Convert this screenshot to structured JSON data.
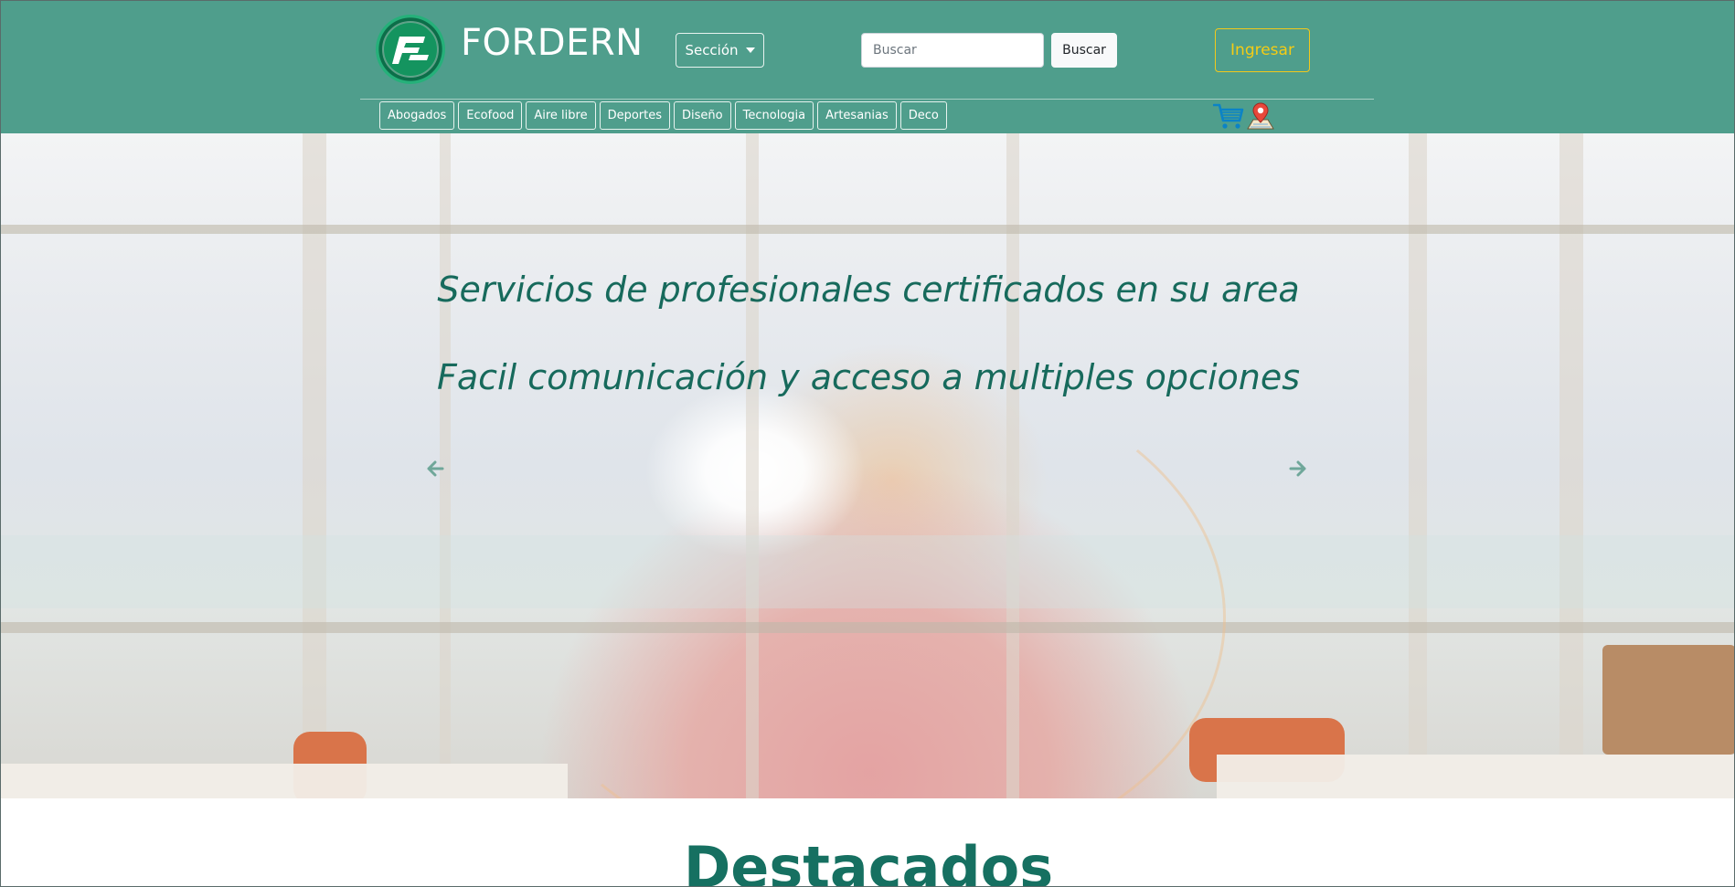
{
  "header": {
    "brand": "FORDERN",
    "section_button": "Sección",
    "search": {
      "placeholder": "Buscar",
      "value": ""
    },
    "search_button": "Buscar",
    "login_button": "Ingresar",
    "categories": [
      "Abogados",
      "Ecofood",
      "Aire libre",
      "Deportes",
      "Diseño",
      "Tecnologia",
      "Artesanias",
      "Deco"
    ],
    "icons": [
      "cart-icon",
      "map-pin-icon"
    ]
  },
  "hero": {
    "slide_line_1": "Servicios de profesionales certificados en su area",
    "slide_line_2": "Facil comunicación y acceso a multiples opciones",
    "controls": [
      "chevron-left-icon",
      "chevron-right-icon"
    ]
  },
  "featured": {
    "title": "Destacados"
  },
  "colors": {
    "header_bg": "#4f9e8c",
    "hero_text": "#176a5c",
    "login_accent": "#f5cc14",
    "featured_title": "#167061"
  }
}
